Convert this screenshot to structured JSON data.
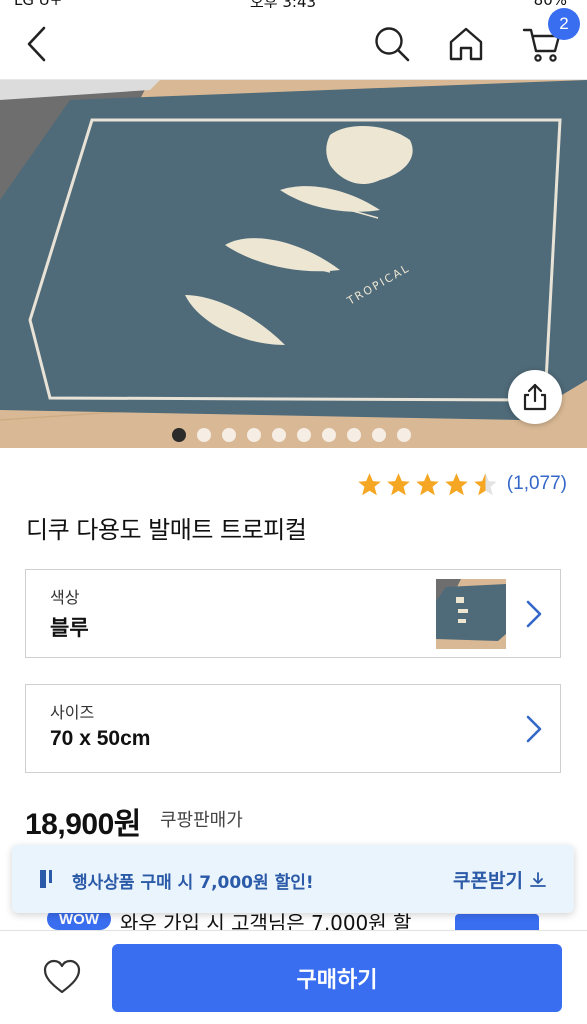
{
  "status_bar": {
    "carrier": "LG U+",
    "time": "오후 3:43",
    "battery": "80%"
  },
  "header": {
    "back_icon": "chevron-left-icon",
    "search_icon": "search-icon",
    "home_icon": "home-icon",
    "cart_icon": "cart-icon",
    "cart_count": "2"
  },
  "gallery": {
    "image_count": 10,
    "active_index": 0,
    "share_icon": "share-icon"
  },
  "rating": {
    "stars": 4.5,
    "count": "(1,077)"
  },
  "product": {
    "title": "디쿠 다용도 발매트 트로피컬"
  },
  "options": [
    {
      "label": "색상",
      "value": "블루"
    },
    {
      "label": "사이즈",
      "value": "70 x 50cm"
    }
  ],
  "price": {
    "amount": "18,900원",
    "note": "쿠팡판매가"
  },
  "wow": {
    "badge": "WOW",
    "text": "와우 가입 시 고객님은 7,000원 할"
  },
  "coupon": {
    "text": "행사상품 구매 시 7,000원 할인!",
    "action": "쿠폰받기"
  },
  "bottom": {
    "wishlist_icon": "heart-icon",
    "buy_label": "구매하기"
  },
  "colors": {
    "accent": "#3a6ef0",
    "link": "#3467c8",
    "star": "#f5a623",
    "coupon_bg": "#eaf4fd"
  }
}
